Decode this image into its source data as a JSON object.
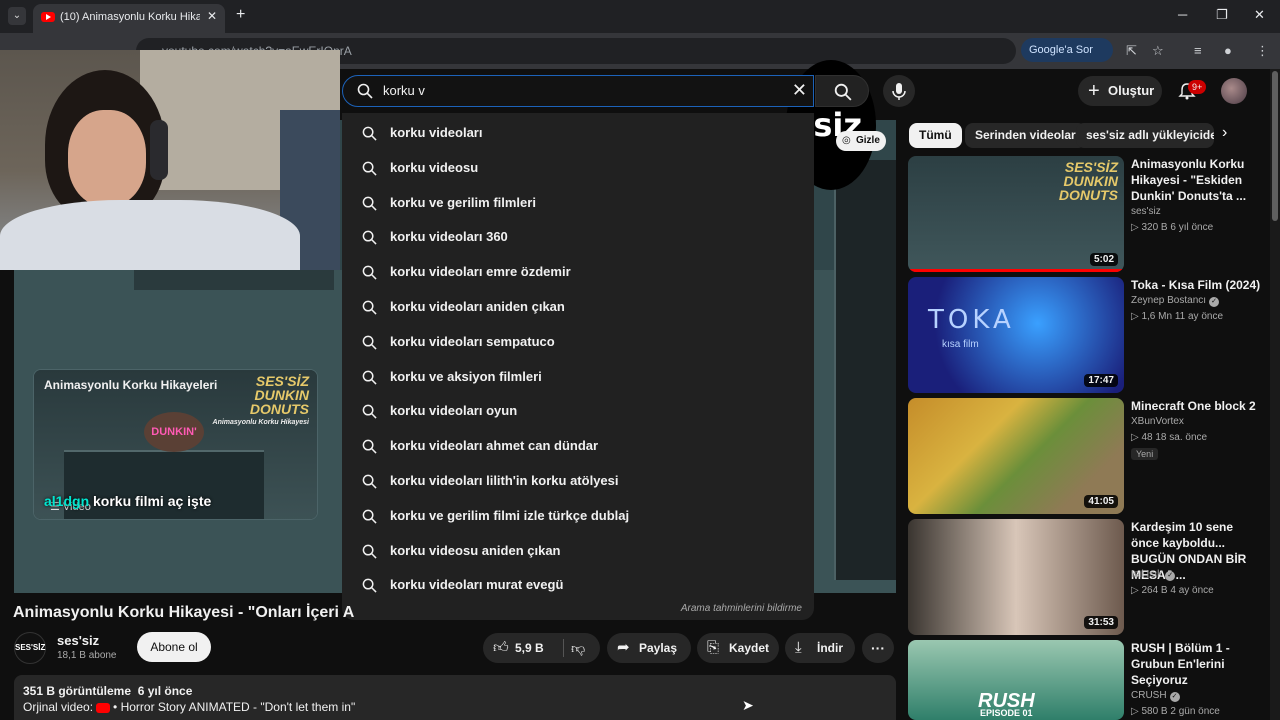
{
  "browser": {
    "tab_title": "(10) Animasyonlu Korku Hikaye",
    "url": "youtube.com/watch?v=aEwErIQnrA",
    "google_button": "Google'a Sor"
  },
  "header": {
    "create_label": "Oluştur",
    "notifications_badge": "9+"
  },
  "search": {
    "value": "korku v",
    "suggestions": [
      "korku videoları",
      "korku videosu",
      "korku ve gerilim filmleri",
      "korku videoları 360",
      "korku videoları emre özdemir",
      "korku videoları aniden çıkan",
      "korku videoları sempatuco",
      "korku ve aksiyon filmleri",
      "korku videoları oyun",
      "korku videoları ahmet can dündar",
      "korku videoları lilith'in korku atölyesi",
      "korku ve gerilim filmi izle türkçe dublaj",
      "korku videosu aniden çıkan",
      "korku videoları murat evegü"
    ],
    "report_label": "Arama tahminlerini bildirme"
  },
  "player": {
    "hide_label": "Gizle",
    "overlay_logo": "siz",
    "card_title": "Animasyonlu Korku Hikayeleri",
    "card_brand": "SES'SİZ",
    "card_brand2": "DUNKIN",
    "card_brand3": "DONUTS",
    "card_brand_sub": "Animasyonlu Korku Hikayesi",
    "card_sign": "DUNKIN'",
    "card_count": "Video",
    "caption_user": "al1dgn",
    "caption_text": " korku filmi aç işte"
  },
  "video": {
    "title": "Animasyonlu Korku Hikayesi - \"Onları İçeri A",
    "channel_logo": "SES'SİZ",
    "channel_name": "ses'siz",
    "subscribers": "18,1 B abone",
    "subscribe_label": "Abone ol",
    "likes": "5,9 B",
    "share_label": "Paylaş",
    "save_label": "Kaydet",
    "download_label": "İndir",
    "views": "351 B görüntüleme",
    "age": "6 yıl önce",
    "original_label": "Orjinal video:",
    "original_link": "• Horror Story ANIMATED - \"Don't let them in\""
  },
  "chips": [
    "Tümü",
    "Serinden videolar",
    "ses'siz adlı yükleyiciden"
  ],
  "recommendations": [
    {
      "title": "Animasyonlu Korku Hikayesi - \"Eskiden Dunkin' Donuts'ta ...",
      "channel": "ses'siz",
      "meta": "▷ 320 B   6 yıl önce",
      "duration": "5:02",
      "brand": "SES'SİZ DUNKIN DONUTS"
    },
    {
      "title": "Toka - Kısa Film (2024)",
      "channel": "Zeynep Bostancı",
      "meta": "▷ 1,6 Mn   11 ay önce",
      "duration": "17:47",
      "thumb_text": "TOKA",
      "thumb_sub": "kısa film"
    },
    {
      "title": "Minecraft One block 2",
      "channel": "XBunVortex",
      "meta": "▷ 48   18 sa. önce",
      "duration": "41:05",
      "tag": "Yeni"
    },
    {
      "title": "Kardeşim 10 sene önce kayboldu... BUGÜN ONDAN BİR MESAJ ...",
      "channel": "Işıl Işık",
      "meta": "▷ 264 B   4 ay önce",
      "duration": "31:53"
    },
    {
      "title": "RUSH | Bölüm 1 - Grubun En'lerini Seçiyoruz",
      "channel": "CRUSH",
      "meta": "▷ 580 B   2 gün önce",
      "thumb_text": "RUSH",
      "thumb_sub": "EPISODE 01"
    }
  ]
}
